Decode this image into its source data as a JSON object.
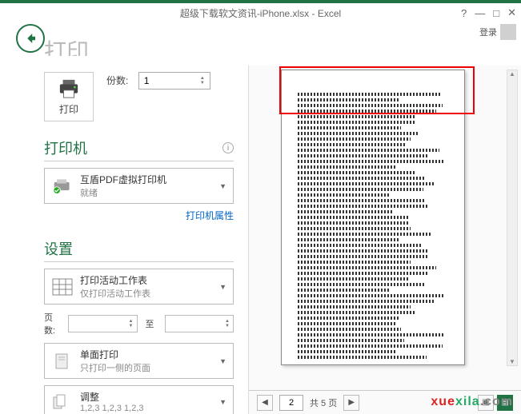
{
  "titlebar": {
    "title": "超级下载软文资讯-iPhone.xlsx - Excel",
    "help": "?",
    "min": "—",
    "max": "□",
    "close": "✕",
    "signin": "登录"
  },
  "heading_partial": "打印",
  "print": {
    "button_label": "打印",
    "copies_label": "份数:",
    "copies_value": "1"
  },
  "printer": {
    "section": "打印机",
    "name": "互盾PDF虚拟打印机",
    "status": "就绪",
    "properties_link": "打印机属性"
  },
  "settings": {
    "section": "设置",
    "active_sheets": {
      "title": "打印活动工作表",
      "sub": "仅打印活动工作表"
    },
    "pages": {
      "label": "页数:",
      "to": "至"
    },
    "single": {
      "title": "单面打印",
      "sub": "只打印一侧的页面"
    },
    "collate": {
      "title": "调整",
      "sub": "1,2,3   1,2,3   1,2,3"
    }
  },
  "pager": {
    "current": "2",
    "total": "共 5 页"
  },
  "watermark": {
    "a": "xue",
    "b": "xila",
    "c": ".com"
  }
}
